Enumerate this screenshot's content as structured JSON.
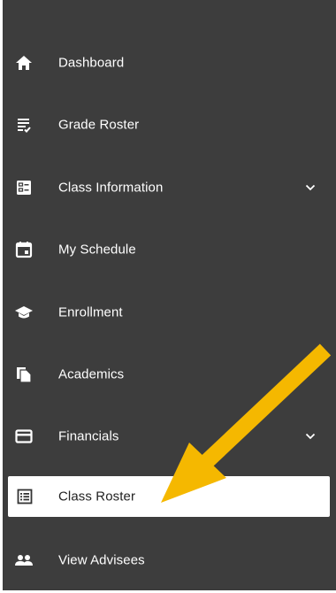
{
  "colors": {
    "sidebar_bg": "#3d3d3d",
    "text": "#ffffff",
    "active_bg": "#ffffff",
    "active_text": "#222222",
    "arrow": "#f5b800"
  },
  "nav": {
    "items": [
      {
        "label": "Dashboard",
        "icon": "home-icon"
      },
      {
        "label": "Grade Roster",
        "icon": "grade-roster-icon"
      },
      {
        "label": "Class Information",
        "icon": "class-info-icon",
        "expandable": true
      },
      {
        "label": "My Schedule",
        "icon": "calendar-icon"
      },
      {
        "label": "Enrollment",
        "icon": "graduation-cap-icon"
      },
      {
        "label": "Academics",
        "icon": "documents-icon"
      },
      {
        "label": "Financials",
        "icon": "credit-card-icon",
        "expandable": true
      },
      {
        "label": "Class Roster",
        "icon": "roster-list-icon",
        "active": true
      },
      {
        "label": "View Advisees",
        "icon": "people-icon"
      }
    ]
  }
}
